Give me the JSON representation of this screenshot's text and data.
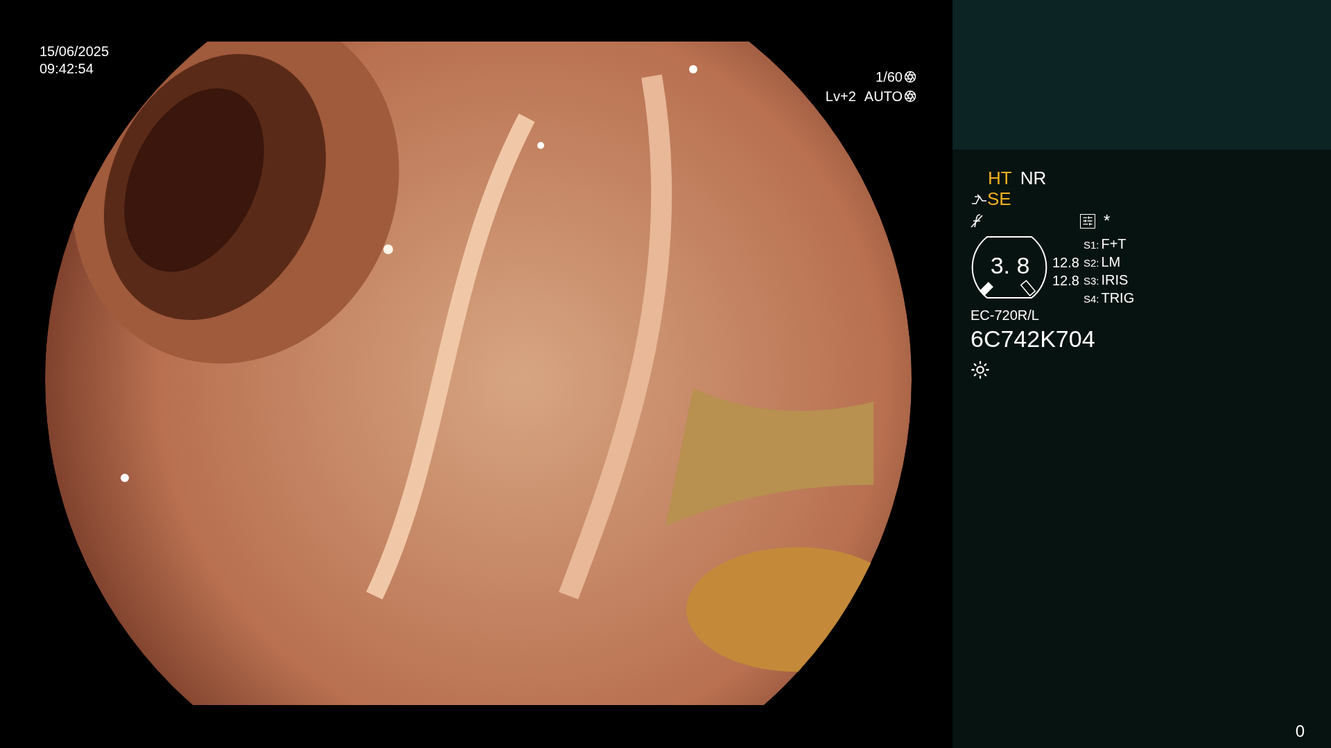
{
  "overlay": {
    "date": "15/06/2025",
    "time": "09:42:54",
    "shutter": "1/60",
    "brightness": "Lv+2",
    "iris": "AUTO"
  },
  "panel": {
    "modes": [
      {
        "label": "HT",
        "on": true
      },
      {
        "label": "NR",
        "on": false
      }
    ],
    "enhancement": {
      "label": "SE",
      "on": true
    },
    "marker": "*",
    "gauge": {
      "value": "3. 8",
      "readings": [
        "12.8",
        "12.8"
      ]
    },
    "switches": [
      {
        "key": "S1:",
        "value": "F+T"
      },
      {
        "key": "S2:",
        "value": "LM"
      },
      {
        "key": "S3:",
        "value": "IRIS"
      },
      {
        "key": "S4:",
        "value": "TRIG"
      }
    ],
    "scope_model": "EC-720R/L",
    "serial": "6C742K704"
  },
  "counter": "0"
}
